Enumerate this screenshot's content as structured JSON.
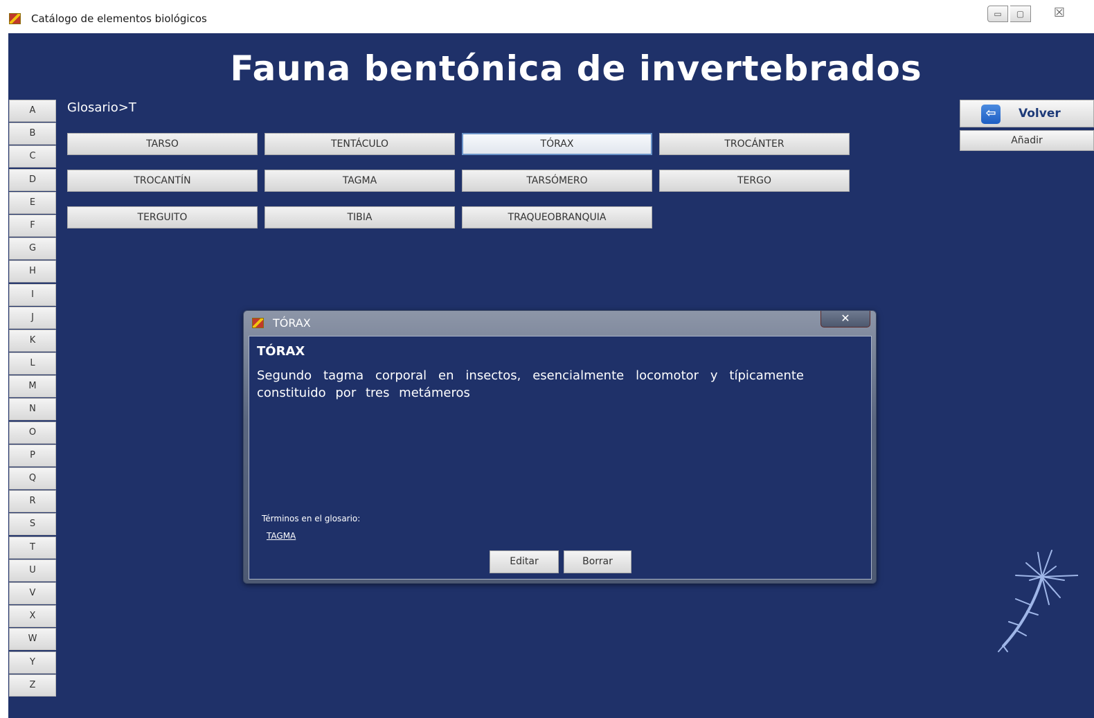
{
  "window": {
    "title": "Catálogo de elementos biológicos",
    "minimize_glyph": "▭",
    "maximize_glyph": "▢",
    "close_glyph": "☒"
  },
  "page": {
    "title": "Fauna bentónica de invertebrados",
    "breadcrumb": "Glosario>T"
  },
  "alphabet": [
    "A",
    "B",
    "C",
    "D",
    "E",
    "F",
    "G",
    "H",
    "I",
    "J",
    "K",
    "L",
    "M",
    "N",
    "O",
    "P",
    "Q",
    "R",
    "S",
    "T",
    "U",
    "V",
    "X",
    "W",
    "Y",
    "Z"
  ],
  "terms": [
    "TARSO",
    "TENTÁCULO",
    "TÓRAX",
    "TROCÁNTER",
    "TROCANTÍN",
    "TAGMA",
    "TARSÓMERO",
    "TERGO",
    "TERGUITO",
    "TIBIA",
    "TRAQUEOBRANQUIA"
  ],
  "selected_term": "TÓRAX",
  "actions": {
    "volver_label": "Volver",
    "volver_icon": "⇦",
    "anadir_label": "Añadir"
  },
  "dialog": {
    "title": "TÓRAX",
    "close_glyph": "✕",
    "term": "TÓRAX",
    "definition": "Segundo tagma corporal en insectos, esencialmente locomotor y típicamente constituido por tres metámeros",
    "glossary_label": "Términos en el glosario:",
    "glossary_links": [
      "TAGMA"
    ],
    "edit_label": "Editar",
    "delete_label": "Borrar"
  },
  "colors": {
    "background": "#1f3169",
    "accent": "#6b93c7"
  }
}
